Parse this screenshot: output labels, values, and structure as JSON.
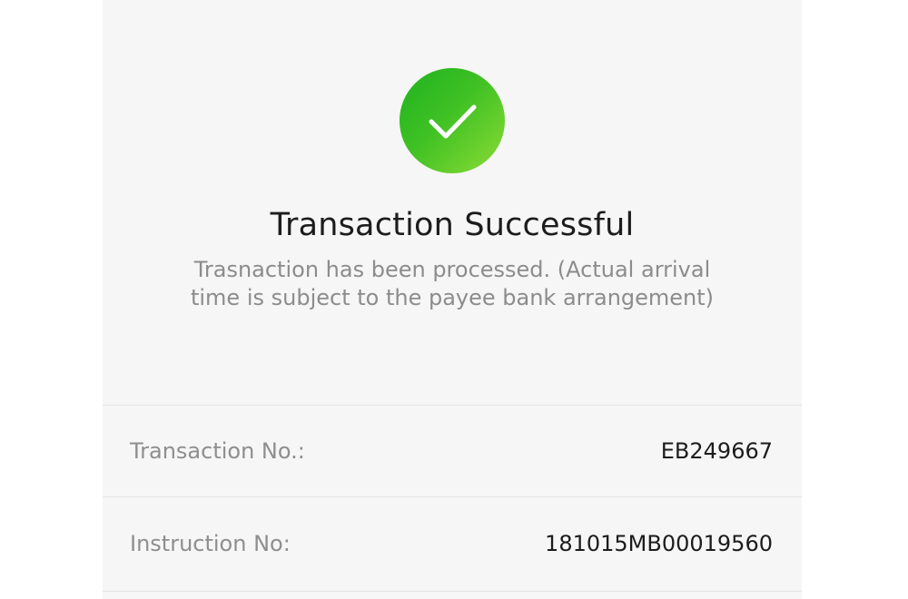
{
  "status": {
    "icon": "checkmark-icon",
    "success_color": "#3fc124",
    "title": "Transaction Successful",
    "message_line1": "Trasnaction has been processed. (Actual arrival",
    "message_line2": "time is subject to the payee bank arrangement)"
  },
  "details": [
    {
      "label": "Transaction No.:",
      "value": "EB249667"
    },
    {
      "label": "Instruction No:",
      "value": "181015MB00019560"
    }
  ]
}
